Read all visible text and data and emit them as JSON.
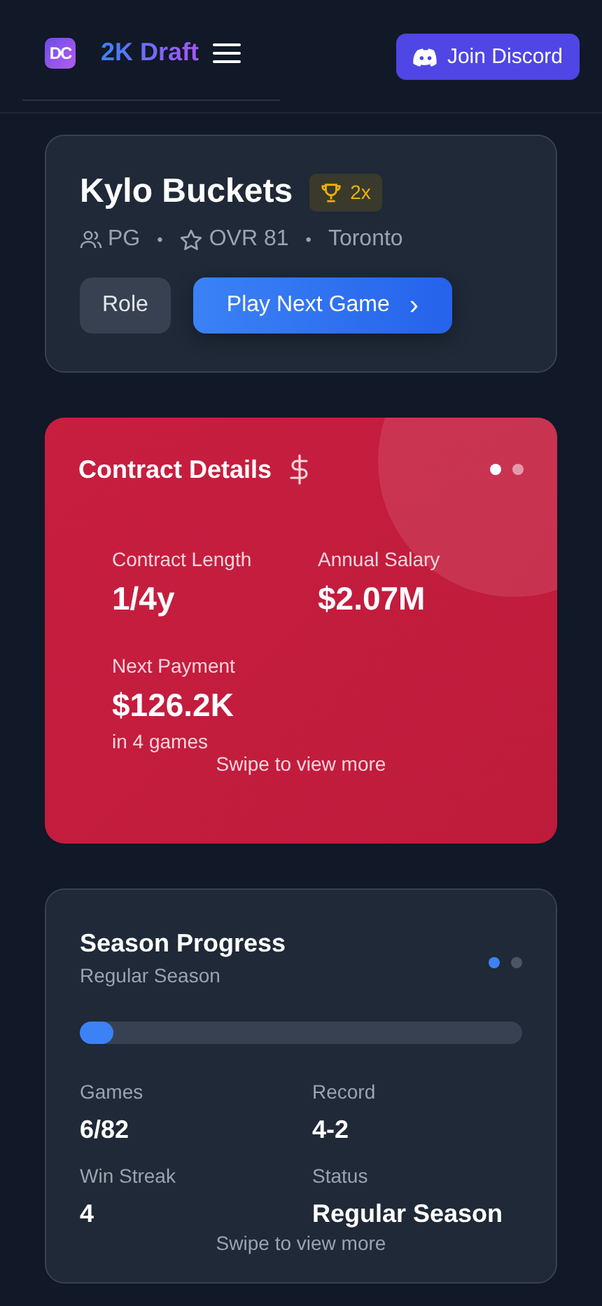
{
  "header": {
    "logo": "DC",
    "brand": "2K Draft",
    "discord_button": "Join Discord"
  },
  "player": {
    "name": "Kylo Buckets",
    "badge": "2x",
    "position": "PG",
    "rating": "OVR 81",
    "team": "Toronto",
    "separator": "•",
    "buttons": [
      {
        "kind": "secondary",
        "label": "Role"
      },
      {
        "kind": "primary",
        "label": "Play Next Game",
        "chevron": "›"
      }
    ]
  },
  "contract": {
    "title": "Contract Details",
    "pager": [
      {
        "selected": true
      },
      {
        "selected": false
      }
    ],
    "stats": [
      {
        "label": "Contract Length",
        "value": "1/4y"
      },
      {
        "label": "Annual Salary",
        "value": "$2.07M"
      },
      {
        "label": "Next Payment",
        "value": "$126.2K",
        "note": "in 4 games"
      }
    ],
    "hint": "Swipe to view more"
  },
  "season": {
    "title": "Season Progress",
    "subtitle": "Regular Season",
    "pager": [
      {
        "selected": true
      },
      {
        "selected": false
      }
    ],
    "level": 0.075,
    "stats": [
      {
        "label": "Games",
        "value": "6/82"
      },
      {
        "label": "Record",
        "value": "4-2"
      },
      {
        "label": "Win Streak",
        "value": "4"
      },
      {
        "label": "Status",
        "value": "Regular Season"
      }
    ],
    "hint": "Swipe to view more"
  }
}
